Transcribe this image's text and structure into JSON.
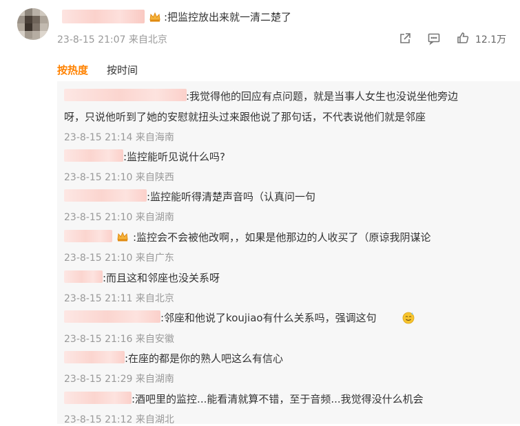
{
  "post": {
    "text": ":把监控放出来就一清二楚了",
    "meta": "23-8-15 21:07 来自北京",
    "like_count": "12.1万",
    "icons": [
      "share-icon",
      "comment-icon",
      "like-icon"
    ]
  },
  "tabs": [
    {
      "label": "按热度",
      "active": true
    },
    {
      "label": "按时间",
      "active": false
    }
  ],
  "replies": [
    {
      "lines": [
        ":我觉得他的回应有点问题，就是当事人女生也没说坐他旁边",
        "呀，只说他听到了她的安慰就扭头过来跟他说了那句话，不代表说他们就是邻座"
      ],
      "meta": "23-8-15 21:14 来自海南"
    },
    {
      "lines": [
        ":监控能听见说什么吗?"
      ],
      "meta": "23-8-15 21:10 来自陕西"
    },
    {
      "lines": [
        ":监控能听得清楚声音吗（认真问一句"
      ],
      "meta": "23-8-15 21:10 来自湖南"
    },
    {
      "lines": [
        ":监控会不会被他改啊，，如果是他那边的人收买了（原谅我阴谋论"
      ],
      "meta": "23-8-15 21:10 来自广东",
      "badge": "crown-icon"
    },
    {
      "lines": [
        ":而且这和邻座也没关系呀"
      ],
      "meta": "23-8-15 21:11 来自北京"
    },
    {
      "lines": [
        ":邻座和他说了koujiao有什么关系吗，强调这句"
      ],
      "meta": "23-8-15 21:16 来自安徽",
      "emoji": "sweat-smile-emoji-icon"
    },
    {
      "lines": [
        ":在座的都是你的熟人吧这么有信心"
      ],
      "meta": "23-8-15 21:29 来自湖南"
    },
    {
      "lines": [
        ":酒吧里的监控...能看清就算不错，至于音频...我觉得没什么机会"
      ],
      "meta": "23-8-15 21:12 来自湖北"
    }
  ],
  "colors": {
    "accent": "#ff8200",
    "meta": "#999999",
    "panel": "#f7f7f7"
  }
}
